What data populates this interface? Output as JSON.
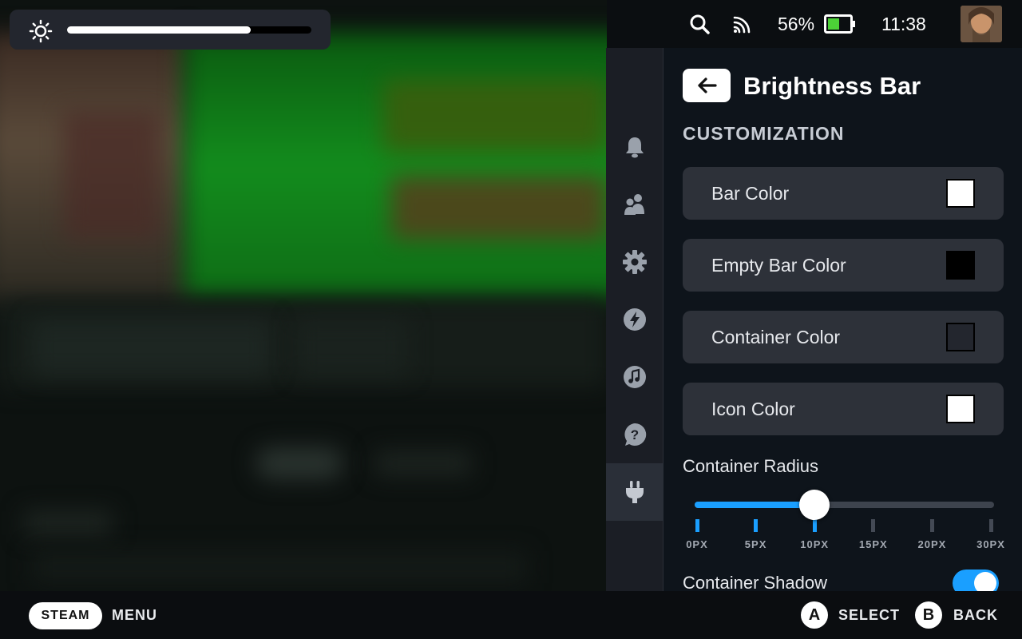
{
  "status": {
    "brightness_level": 0.75,
    "battery": "56%",
    "time": "11:38"
  },
  "sidenav": {
    "items": [
      {
        "id": "notifications",
        "icon": "bell-icon"
      },
      {
        "id": "friends",
        "icon": "friends-icon"
      },
      {
        "id": "settings",
        "icon": "gear-icon"
      },
      {
        "id": "performance",
        "icon": "lightning-icon"
      },
      {
        "id": "music",
        "icon": "music-note-icon"
      },
      {
        "id": "help",
        "icon": "help-icon"
      },
      {
        "id": "plugins",
        "icon": "plug-icon",
        "active": true
      }
    ]
  },
  "panel": {
    "title": "Brightness Bar",
    "section": "CUSTOMIZATION",
    "color_options": [
      {
        "label": "Bar Color",
        "color": "#ffffff"
      },
      {
        "label": "Empty Bar Color",
        "color": "#000000"
      },
      {
        "label": "Container Color",
        "color": "#23262e"
      },
      {
        "label": "Icon Color",
        "color": "#ffffff"
      }
    ],
    "radius": {
      "label": "Container Radius",
      "value": 10,
      "ticks": [
        "0PX",
        "5PX",
        "10PX",
        "15PX",
        "20PX",
        "30PX"
      ]
    },
    "shadow": {
      "label": "Container Shadow",
      "enabled": true
    }
  },
  "footer": {
    "steam": "STEAM",
    "menu": "MENU",
    "a_button": "A",
    "select": "SELECT",
    "b_button": "B",
    "back": "BACK"
  },
  "colors": {
    "accent": "#1a9fff",
    "panel_bg": "#0e141b",
    "row_bg": "#2d3139"
  }
}
